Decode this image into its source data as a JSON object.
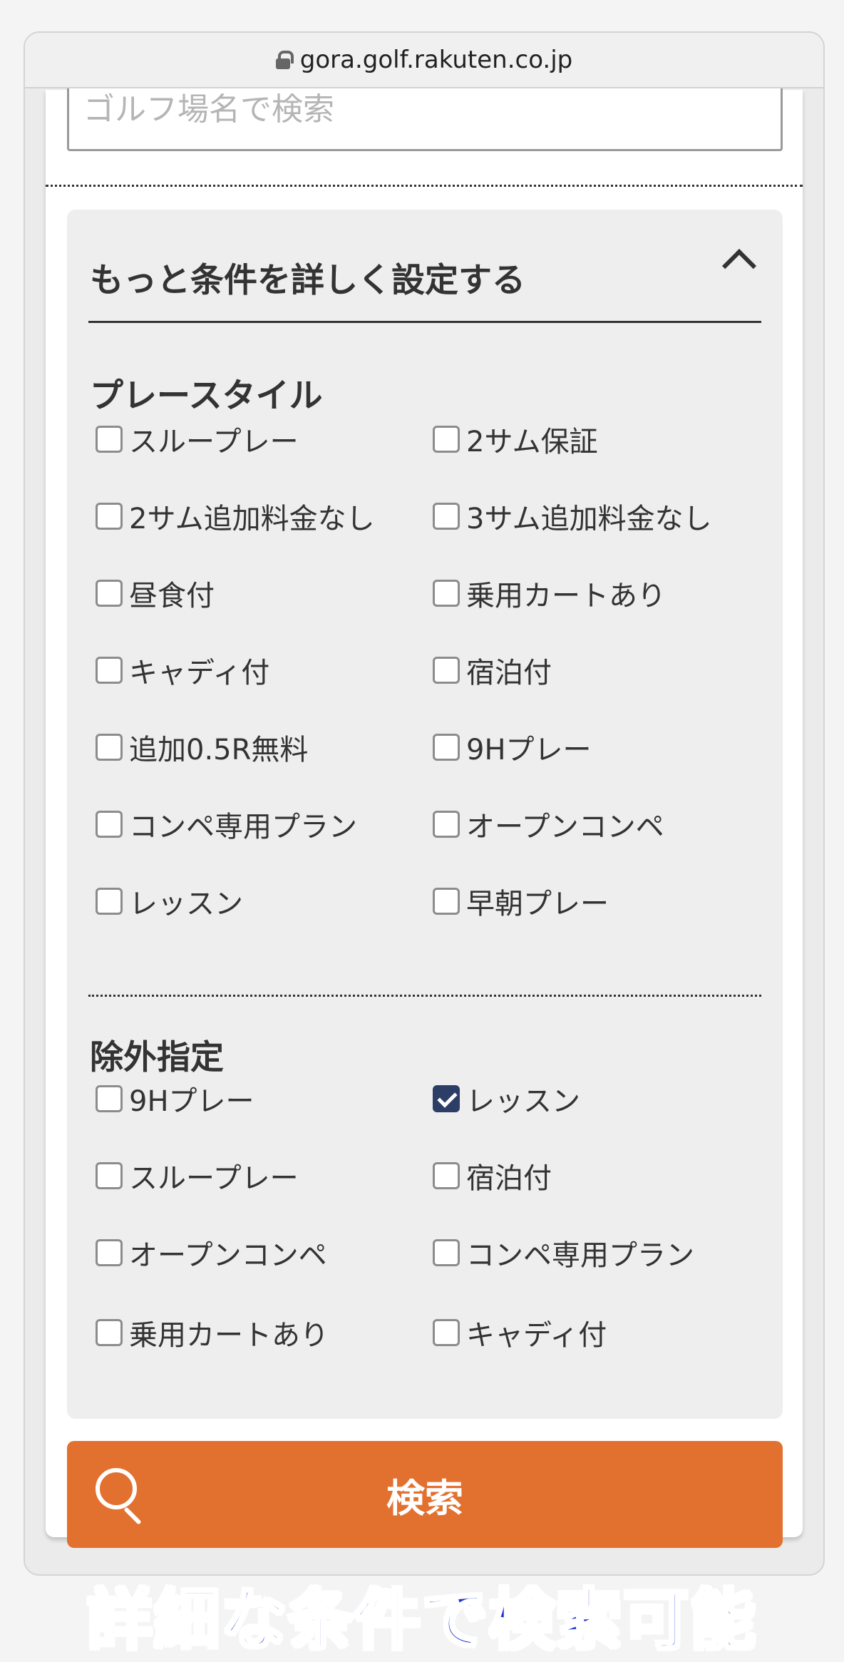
{
  "browser": {
    "url": "gora.golf.rakuten.co.jp"
  },
  "search": {
    "placeholder": "ゴルフ場名で検索"
  },
  "accordion": {
    "title": "もっと条件を詳しく設定する"
  },
  "play_style": {
    "title": "プレースタイル",
    "options": [
      {
        "label": "スループレー",
        "checked": false
      },
      {
        "label": "2サム保証",
        "checked": false
      },
      {
        "label": "2サム追加料金なし",
        "checked": false
      },
      {
        "label": "3サム追加料金なし",
        "checked": false
      },
      {
        "label": "昼食付",
        "checked": false
      },
      {
        "label": "乗用カートあり",
        "checked": false
      },
      {
        "label": "キャディ付",
        "checked": false
      },
      {
        "label": "宿泊付",
        "checked": false
      },
      {
        "label": "追加0.5R無料",
        "checked": false
      },
      {
        "label": "9Hプレー",
        "checked": false
      },
      {
        "label": "コンペ専用プラン",
        "checked": false
      },
      {
        "label": "オープンコンペ",
        "checked": false
      },
      {
        "label": "レッスン",
        "checked": false
      },
      {
        "label": "早朝プレー",
        "checked": false
      }
    ]
  },
  "exclusions": {
    "title": "除外指定",
    "options": [
      {
        "label": "9Hプレー",
        "checked": false
      },
      {
        "label": "レッスン",
        "checked": true
      },
      {
        "label": "スループレー",
        "checked": false
      },
      {
        "label": "宿泊付",
        "checked": false
      },
      {
        "label": "オープンコンペ",
        "checked": false
      },
      {
        "label": "コンペ専用プラン",
        "checked": false
      },
      {
        "label": "乗用カートあり",
        "checked": false
      },
      {
        "label": "キャディ付",
        "checked": false
      }
    ]
  },
  "search_button": {
    "label": "検索"
  },
  "caption": {
    "text": "詳細な条件で検索可能"
  },
  "colors": {
    "accent": "#e2702e",
    "checkbox_checked": "#2c3e66",
    "caption": "#1b33d6"
  }
}
